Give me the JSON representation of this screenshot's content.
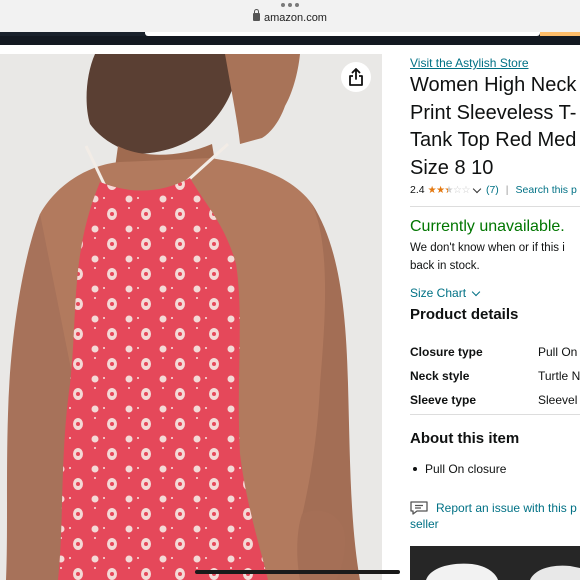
{
  "browser": {
    "url": "amazon.com"
  },
  "product": {
    "store_link": "Visit the Astylish Store",
    "title_lines": [
      "Women High Neck",
      "Print Sleeveless T-",
      "Tank Top Red Med",
      "Size 8 10"
    ],
    "rating": {
      "score": "2.4",
      "stars": 2.4,
      "count": "(7)",
      "separator": "|",
      "search_link": "Search this p"
    },
    "availability": {
      "status": "Currently unavailable.",
      "note_lines": [
        "We don't know when or if this i",
        "back in stock."
      ]
    },
    "size_chart": "Size Chart",
    "details_title": "Product details",
    "details": [
      {
        "key": "Closure type",
        "value": "Pull On"
      },
      {
        "key": "Neck style",
        "value": "Turtle N"
      },
      {
        "key": "Sleeve type",
        "value": "Sleevel"
      }
    ],
    "about_title": "About this item",
    "about_items": [
      "Pull On closure"
    ],
    "report": {
      "line1": "Report an issue with this p",
      "line2": "seller"
    }
  },
  "colors": {
    "link": "#007185",
    "available_green": "#007600",
    "star": "#e47911",
    "top_color": "#e5485a",
    "header_dark": "#131921"
  },
  "icons": {
    "share": "share-icon",
    "report": "report-comment-icon",
    "lock": "lock-icon"
  }
}
